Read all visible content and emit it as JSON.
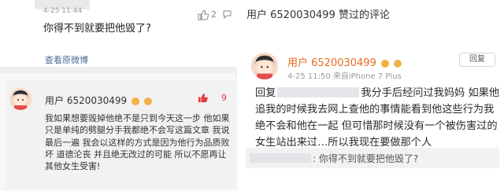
{
  "left": {
    "comment": {
      "time": "4-25 11:44",
      "text": "你得不到就要把他毁了?",
      "likes": "2",
      "view_original": "查看原微博"
    },
    "reply": {
      "username": "用户 6520030499",
      "likes": "9",
      "body": "我如果想要毁掉他绝不是只到今天这一步 他如果只是单纯的劈腿分手我都绝不会写这篇文章 我说最后一遍 我会以这样的方式是因为他行为品质败坏 道德沦丧 并且绝无改过的可能 所以不愿再让其他女生受害!"
    }
  },
  "right": {
    "title": "用户 6520030499 赞过的评论",
    "username": "用户 6520030499",
    "time_device": "4-25 11:50 来自iPhone 7 Plus",
    "reply_button": "回复",
    "body_prefix": "回复",
    "body_text": "我分手后经问过我妈妈 如果他追我的时候我去网上查他的事情能看到他这些行为我绝不会和他在一起 但可惜那时候没有一个被伤害过的女生站出来过…所以我现在要做那个人",
    "quote_text": ": 你得不到就要把他毁了?"
  },
  "colors": {
    "username_orange": "#e56b1f",
    "link_blue": "#4b6b94",
    "like_red": "#e2393e"
  }
}
